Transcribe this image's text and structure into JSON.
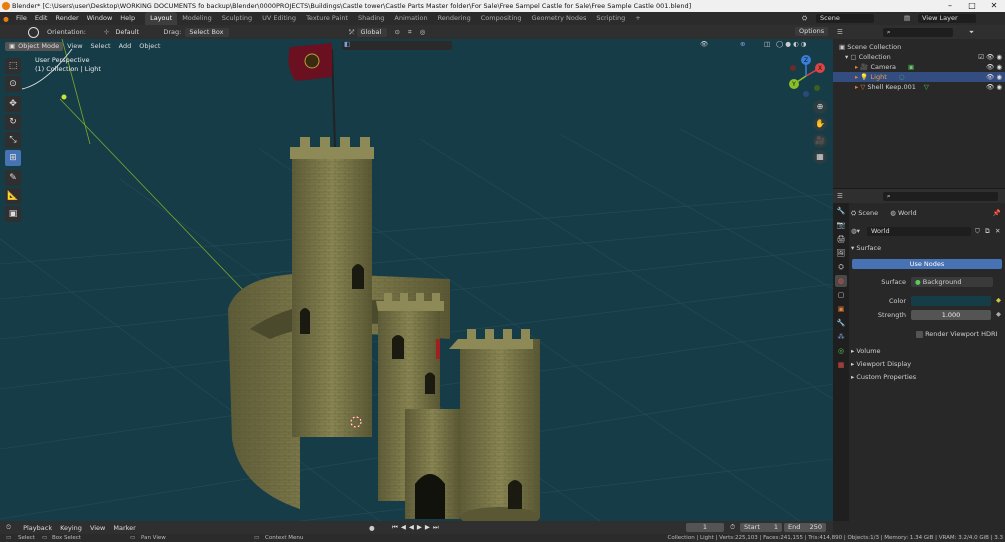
{
  "title": "Blender* [C:\\Users\\user\\Desktop\\WORKING DOCUMENTS fo backup\\Blender\\0000PROJECTS\\Buildings\\Castle tower\\Castle Parts Master folder\\For Sale\\Free Sampel Castle for Sale\\Free Sample Castle 001.blend]",
  "menus": [
    "File",
    "Edit",
    "Render",
    "Window",
    "Help"
  ],
  "workspaces": [
    "Layout",
    "Modeling",
    "Sculpting",
    "UV Editing",
    "Texture Paint",
    "Shading",
    "Animation",
    "Rendering",
    "Compositing",
    "Geometry Nodes",
    "Scripting",
    "+"
  ],
  "scene": "Scene",
  "view_layer": "View Layer",
  "header": {
    "orientation_label": "Orientation:",
    "orientation_value": "Default",
    "drag_label": "Drag:",
    "drag_value": "Select Box",
    "transform": "Global",
    "options": "Options"
  },
  "viewport_header": {
    "mode": "Object Mode",
    "menu": [
      "View",
      "Select",
      "Add",
      "Object"
    ]
  },
  "viewport_info": {
    "line1": "User Perspective",
    "line2": "(1) Collection | Light"
  },
  "gizmo": {
    "x": "X",
    "y": "Y",
    "z": "Z"
  },
  "outliner": {
    "scene_collection": "Scene Collection",
    "collection": "Collection",
    "items": [
      "Camera",
      "Light",
      "Shell Keep.001"
    ]
  },
  "properties": {
    "breadcrumb_scene": "Scene",
    "breadcrumb_world": "World",
    "world_name": "World",
    "surface_header": "Surface",
    "use_nodes": "Use Nodes",
    "surface_label": "Surface",
    "surface_value": "Background",
    "color_label": "Color",
    "strength_label": "Strength",
    "strength_value": "1.000",
    "hdri_label": "Render Viewport HDRI",
    "volume": "Volume",
    "viewport_display": "Viewport Display",
    "custom_properties": "Custom Properties"
  },
  "timeline": {
    "menus": [
      "Playback",
      "Keying",
      "View",
      "Marker"
    ],
    "current_frame": "1",
    "start_label": "Start",
    "start_value": "1",
    "end_label": "End",
    "end_value": "250"
  },
  "status": {
    "select": "Select",
    "box_select": "Box Select",
    "pan_view": "Pan View",
    "context_menu": "Context Menu",
    "stats": "Collection | Light | Verts:225,103 | Faces:241,155 | Tris:414,890 | Objects:1/3 | Memory: 1.34 GiB | VRAM: 3.2/4.0 GiB | 3.3"
  },
  "colors": {
    "viewport_bg": "#163c47",
    "accent": "#4772b3",
    "grid": "#2a5560",
    "stone": "#7d7a4e",
    "flag": "#6b1020"
  }
}
